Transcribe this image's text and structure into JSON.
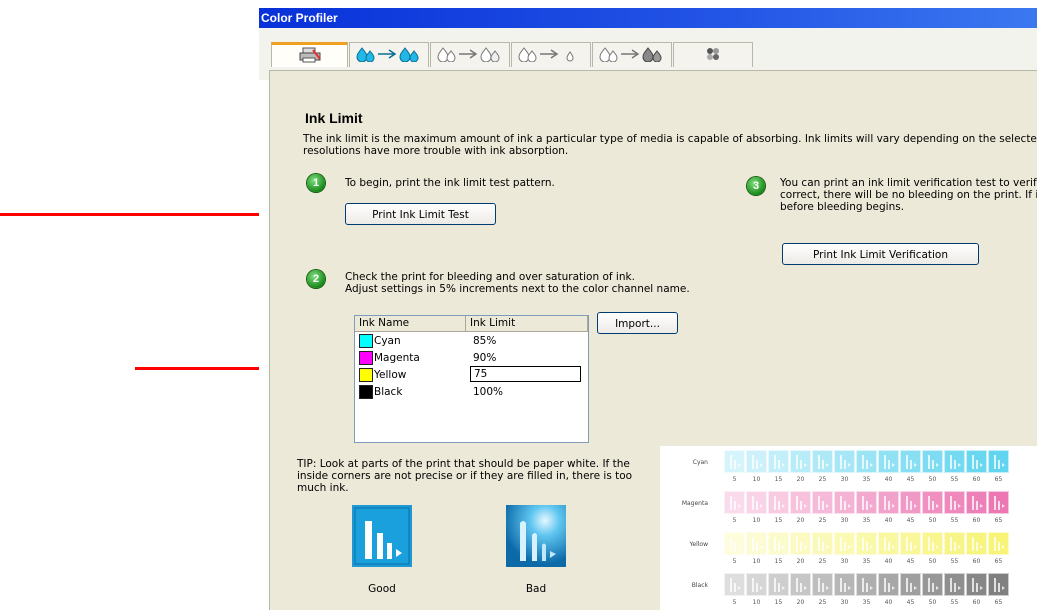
{
  "window": {
    "title": "Color Profiler"
  },
  "tabs": [
    {
      "name": "tab-printer",
      "icon": "printer-icon"
    },
    {
      "name": "tab-ink-limit",
      "icon": "ink-drops-arrow-icon"
    },
    {
      "name": "tab-linearization",
      "icon": "ink-drops-outline-arrow-icon"
    },
    {
      "name": "tab-total-ink",
      "icon": "ink-drops-small-arrow-icon"
    },
    {
      "name": "tab-profile",
      "icon": "ink-drops-dark-arrow-icon"
    },
    {
      "name": "tab-patches",
      "icon": "color-patch-icon"
    }
  ],
  "section": {
    "title": "Ink Limit",
    "description_line1": "The ink limit is the maximum amount of ink a particular type of media is capable of absorbing. Ink limits will vary depending on the selected pri",
    "description_line2": "resolutions have more trouble with ink absorption."
  },
  "step1": {
    "number": "1",
    "text": "To begin, print the ink limit test pattern.",
    "button": "Print Ink Limit Test"
  },
  "step2": {
    "number": "2",
    "text_line1": "Check the print for bleeding and over saturation of ink.",
    "text_line2": "Adjust settings in 5% increments next to the color channel name.",
    "import_button": "Import..."
  },
  "step3": {
    "number": "3",
    "text_line1": "You can print an ink limit verification test to verify",
    "text_line2": "correct, there will be no bleeding on the print. If i",
    "text_line3": "before bleeding begins.",
    "button": "Print Ink Limit Verification"
  },
  "ink_table": {
    "headers": [
      "Ink Name",
      "Ink Limit"
    ],
    "rows": [
      {
        "name": "Cyan",
        "limit": "85%",
        "color": "#00ffff"
      },
      {
        "name": "Magenta",
        "limit": "90%",
        "color": "#ff00ff"
      },
      {
        "name": "Yellow",
        "limit": "75",
        "color": "#ffff00",
        "editing": true
      },
      {
        "name": "Black",
        "limit": "100%",
        "color": "#000000"
      }
    ]
  },
  "tip": {
    "line1": "TIP: Look at parts of the print that should be paper white. If the",
    "line2": "inside corners are not precise or if they are filled in, there is too",
    "line3": "much ink.",
    "good_label": "Good",
    "bad_label": "Bad"
  },
  "sample_grid": {
    "rows": [
      {
        "label": "Cyan",
        "color": "#2cc6ea"
      },
      {
        "label": "Magenta",
        "color": "#e64a9a"
      },
      {
        "label": "Yellow",
        "color": "#f5f04a"
      },
      {
        "label": "Black",
        "color": "#555555"
      }
    ],
    "increments": [
      "5",
      "10",
      "15",
      "20",
      "25",
      "30",
      "35",
      "40",
      "45",
      "50",
      "55",
      "60",
      "65"
    ]
  }
}
